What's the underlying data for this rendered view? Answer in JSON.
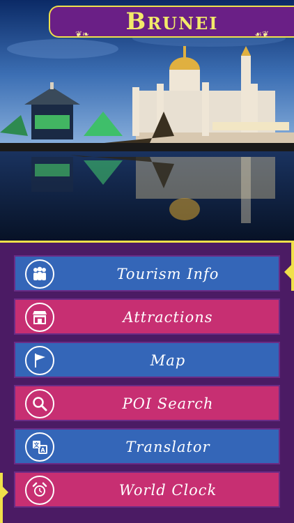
{
  "header": {
    "title": "Brunei"
  },
  "menu": {
    "items": [
      {
        "label": "Tourism Info",
        "icon": "people-icon",
        "color": "#3466b8"
      },
      {
        "label": "Attractions",
        "icon": "shop-icon",
        "color": "#c72f72"
      },
      {
        "label": "Map",
        "icon": "flag-icon",
        "color": "#3466b8"
      },
      {
        "label": "POI Search",
        "icon": "magnifier-icon",
        "color": "#c72f72"
      },
      {
        "label": "Translator",
        "icon": "translate-icon",
        "color": "#3466b8"
      },
      {
        "label": "World Clock",
        "icon": "alarm-clock-icon",
        "color": "#c72f72"
      }
    ]
  },
  "colors": {
    "accent": "#f0e04a",
    "panel": "#4b1b64",
    "banner": "#6a1f86"
  }
}
